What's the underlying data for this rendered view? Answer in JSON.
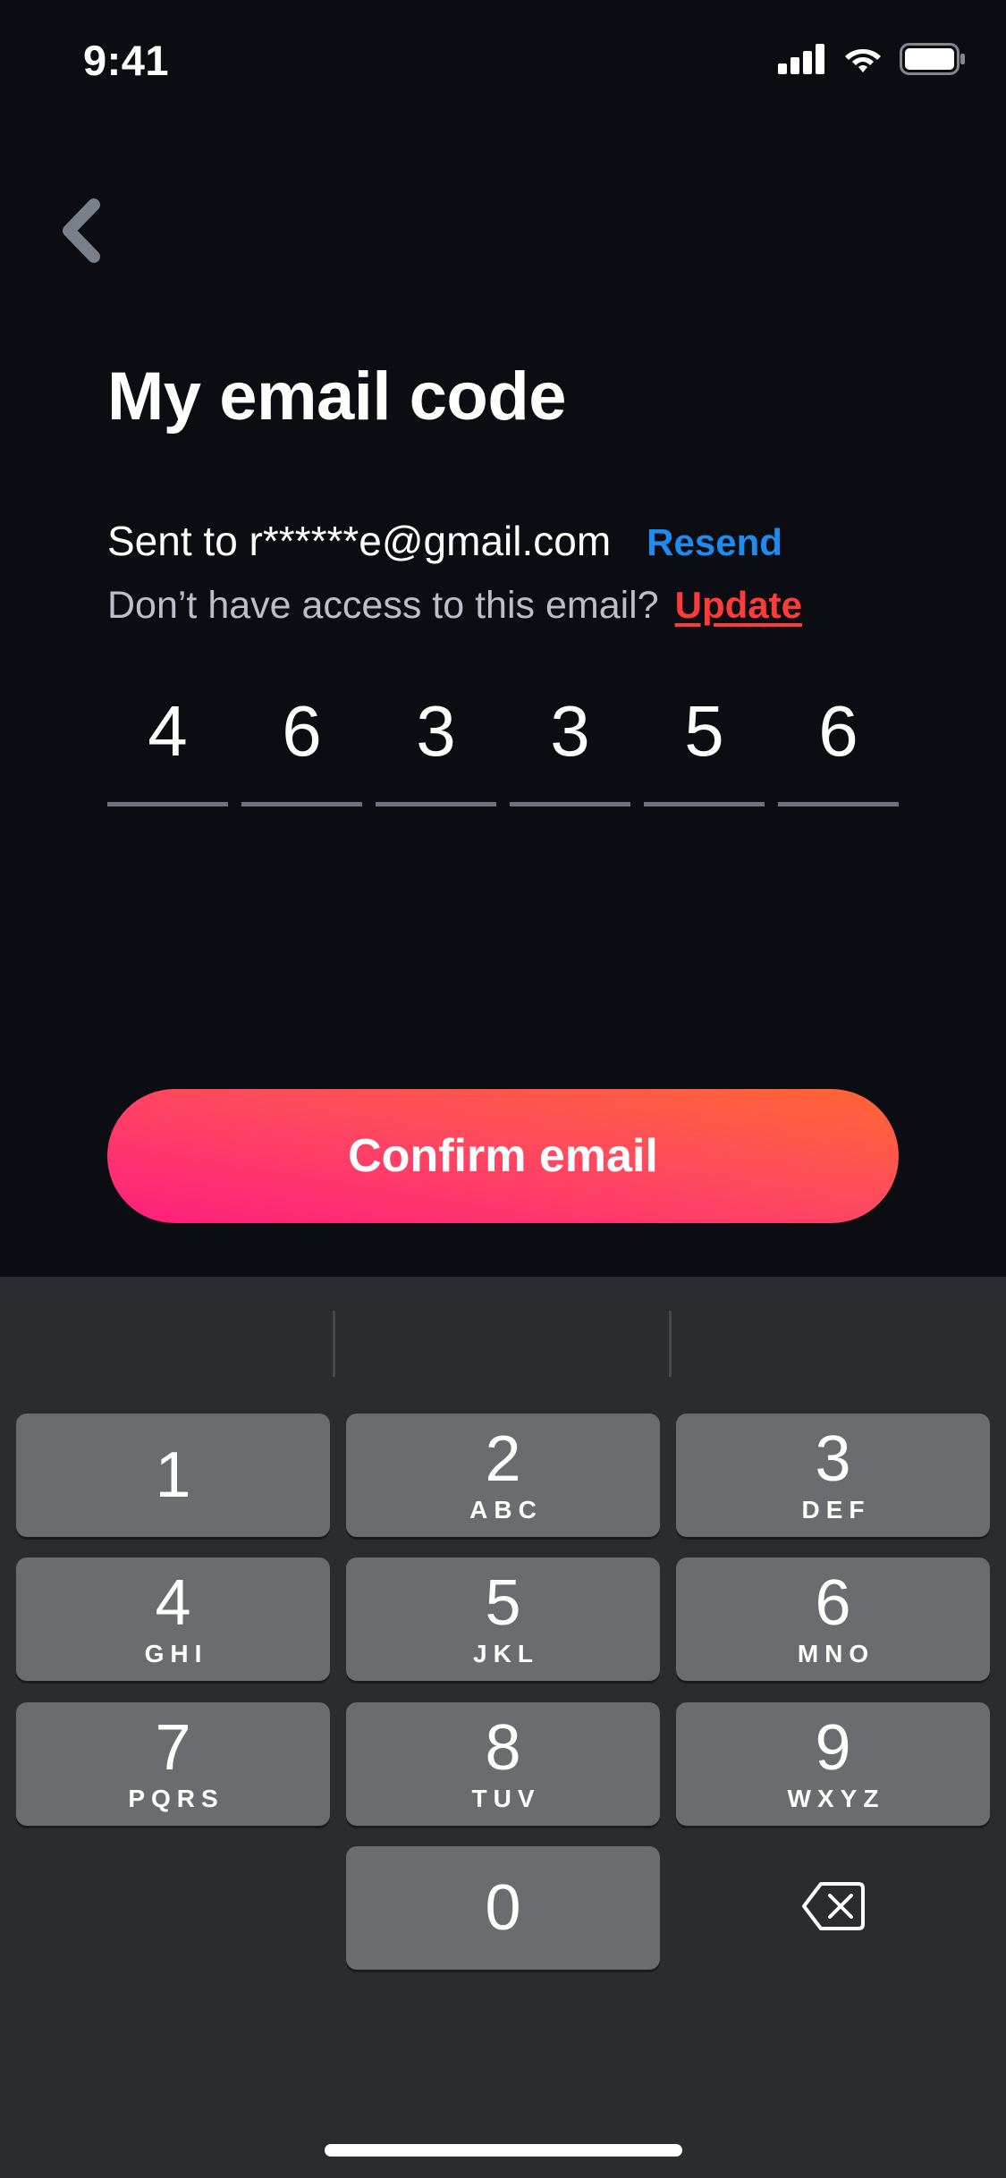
{
  "status_bar": {
    "time": "9:41",
    "icons": [
      "signal-icon",
      "wifi-icon",
      "battery-icon"
    ]
  },
  "nav": {
    "back_icon": "chevron-left-icon"
  },
  "title": "My email code",
  "sent": {
    "text": "Sent to r******e@gmail.com",
    "resend_label": "Resend"
  },
  "access": {
    "text": "Don’t have access to this email?",
    "update_label": "Update"
  },
  "code_digits": [
    "4",
    "6",
    "3",
    "3",
    "5",
    "6"
  ],
  "confirm_label": "Confirm email",
  "keyboard": {
    "keys": [
      {
        "num": "1",
        "letters": ""
      },
      {
        "num": "2",
        "letters": "ABC"
      },
      {
        "num": "3",
        "letters": "DEF"
      },
      {
        "num": "4",
        "letters": "GHI"
      },
      {
        "num": "5",
        "letters": "JKL"
      },
      {
        "num": "6",
        "letters": "MNO"
      },
      {
        "num": "7",
        "letters": "PQRS"
      },
      {
        "num": "8",
        "letters": "TUV"
      },
      {
        "num": "9",
        "letters": "WXYZ"
      },
      {
        "num": "0",
        "letters": ""
      }
    ],
    "delete_icon": "backspace-icon"
  },
  "colors": {
    "background": "#0b0d12",
    "resend": "#1e8bf0",
    "update": "#ff3a3a",
    "button_gradient_start": "#ff1f7e",
    "button_gradient_end": "#ff6633",
    "keyboard_bg": "#2b2c2f",
    "key_bg": "#6b6c70"
  }
}
